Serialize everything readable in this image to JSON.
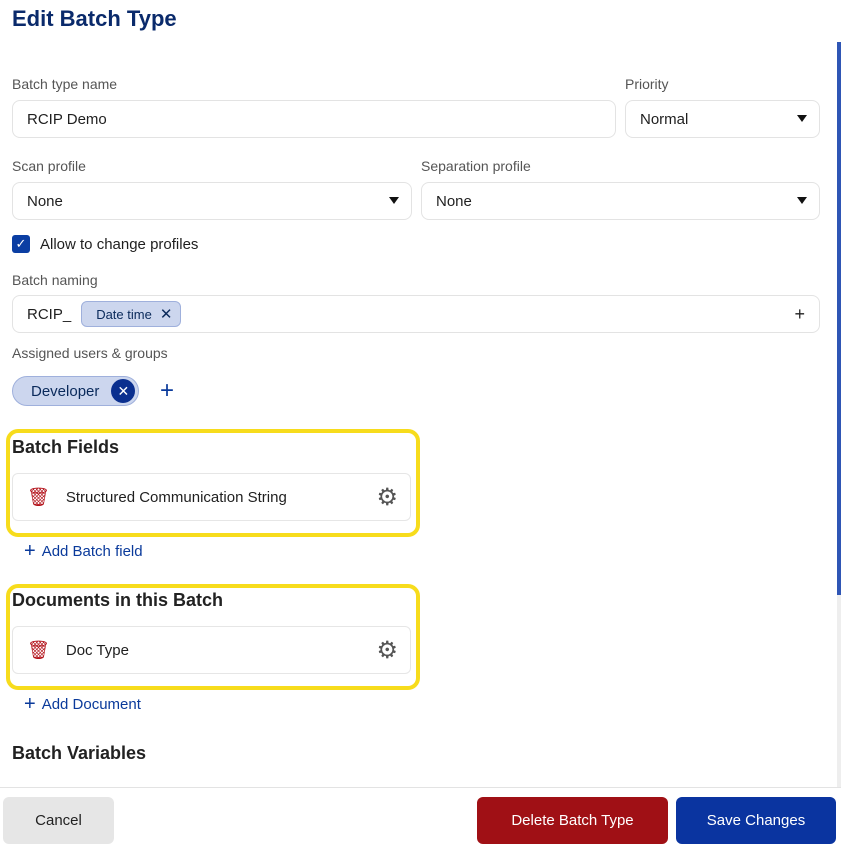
{
  "title": "Edit Batch Type",
  "batch_type_name": {
    "label": "Batch type name",
    "value": "RCIP Demo"
  },
  "priority": {
    "label": "Priority",
    "value": "Normal"
  },
  "scan_profile": {
    "label": "Scan profile",
    "value": "None"
  },
  "separation_profile": {
    "label": "Separation profile",
    "value": "None"
  },
  "allow_change_profiles": {
    "label": "Allow to change profiles",
    "checked": true
  },
  "batch_naming": {
    "label": "Batch naming",
    "prefix": "RCIP_",
    "token": "Date time",
    "add": "+"
  },
  "assigned": {
    "label": "Assigned users & groups",
    "chips": [
      "Developer"
    ],
    "add": "+"
  },
  "batch_fields": {
    "title": "Batch Fields",
    "items": [
      "Structured Communication String"
    ],
    "add_label": "Add Batch field"
  },
  "documents": {
    "title": "Documents in this Batch",
    "items": [
      "Doc Type"
    ],
    "add_label": "Add Document"
  },
  "batch_variables": {
    "title": "Batch Variables"
  },
  "footer": {
    "cancel": "Cancel",
    "delete": "Delete Batch Type",
    "save": "Save Changes"
  }
}
